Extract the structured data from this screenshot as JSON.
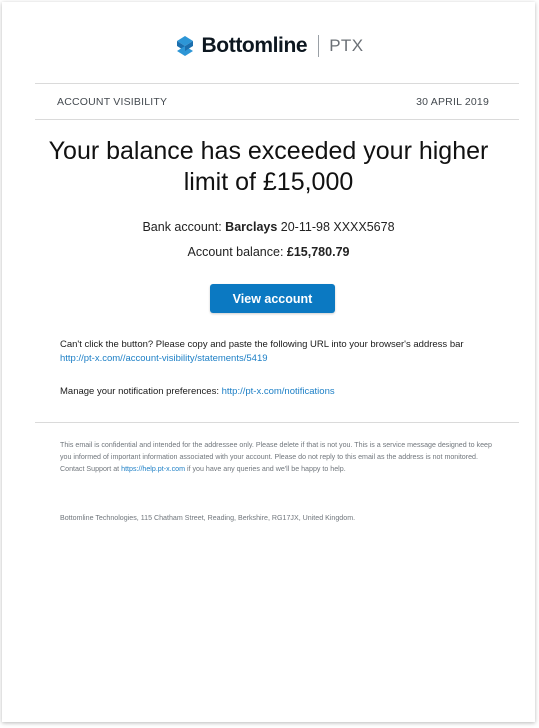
{
  "brand": {
    "name": "Bottomline",
    "product": "PTX",
    "accent_color": "#0b79c2",
    "logo_icon": "bottomline-s-icon"
  },
  "header": {
    "category": "ACCOUNT VISIBILITY",
    "date": "30 APRIL 2019"
  },
  "headline": "Your balance has exceeded your higher limit of £15,000",
  "bank_account": {
    "label": "Bank account:",
    "bank": "Barclays",
    "details": "20-11-98 XXXX5678"
  },
  "balance": {
    "label": "Account balance:",
    "value": "£15,780.79"
  },
  "cta": {
    "label": "View account",
    "color": "#0b79c2"
  },
  "fallback": {
    "text": "Can't click the button? Please copy and paste the following URL into your browser's address bar",
    "url": "http://pt-x.com//account-visibility/statements/5419"
  },
  "notifications": {
    "label": "Manage your notification preferences:",
    "url": "http://pt-x.com/notifications"
  },
  "footer": {
    "disclaimer_before": "This email is confidential and intended for the addressee only. Please delete if that is not you. This is a service message designed to keep you informed of important information associated with your account. Please do not reply to this email as the address is not monitored. Contact Support at ",
    "support_url": "https://help.pt-x.com",
    "disclaimer_after": " if you have any queries and we'll be happy to help.",
    "address": "Bottomline Technologies, 115 Chatham Street, Reading, Berkshire, RG17JX, United Kingdom."
  }
}
